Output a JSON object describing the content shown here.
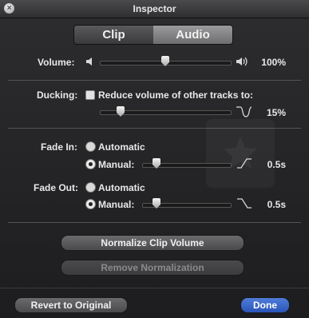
{
  "window": {
    "title": "Inspector",
    "close_glyph": "×"
  },
  "tabs": [
    {
      "label": "Clip"
    },
    {
      "label": "Audio"
    }
  ],
  "volume": {
    "label": "Volume:",
    "value": "100%",
    "level": 0.52
  },
  "ducking": {
    "label": "Ducking:",
    "checkbox_label": "Reduce volume of other tracks to:",
    "value": "15%",
    "checked": false,
    "level": 0.15
  },
  "fade_in": {
    "label": "Fade In:",
    "automatic_label": "Automatic",
    "manual_label": "Manual:",
    "value": "0.5s",
    "selected": "manual",
    "level": 0.12
  },
  "fade_out": {
    "label": "Fade Out:",
    "automatic_label": "Automatic",
    "manual_label": "Manual:",
    "value": "0.5s",
    "selected": "manual",
    "level": 0.12
  },
  "buttons": {
    "normalize": "Normalize Clip Volume",
    "remove_normalization": "Remove Normalization",
    "revert": "Revert to Original",
    "done": "Done"
  },
  "icons": {
    "close": "close-icon",
    "speaker_low": "speaker-low-icon",
    "speaker_high": "speaker-high-icon",
    "duck": "duck-curve-icon",
    "fade_in": "fade-in-curve-icon",
    "fade_out": "fade-out-curve-icon"
  },
  "colors": {
    "background": "#1f1f21",
    "accent": "#3a65c9"
  }
}
